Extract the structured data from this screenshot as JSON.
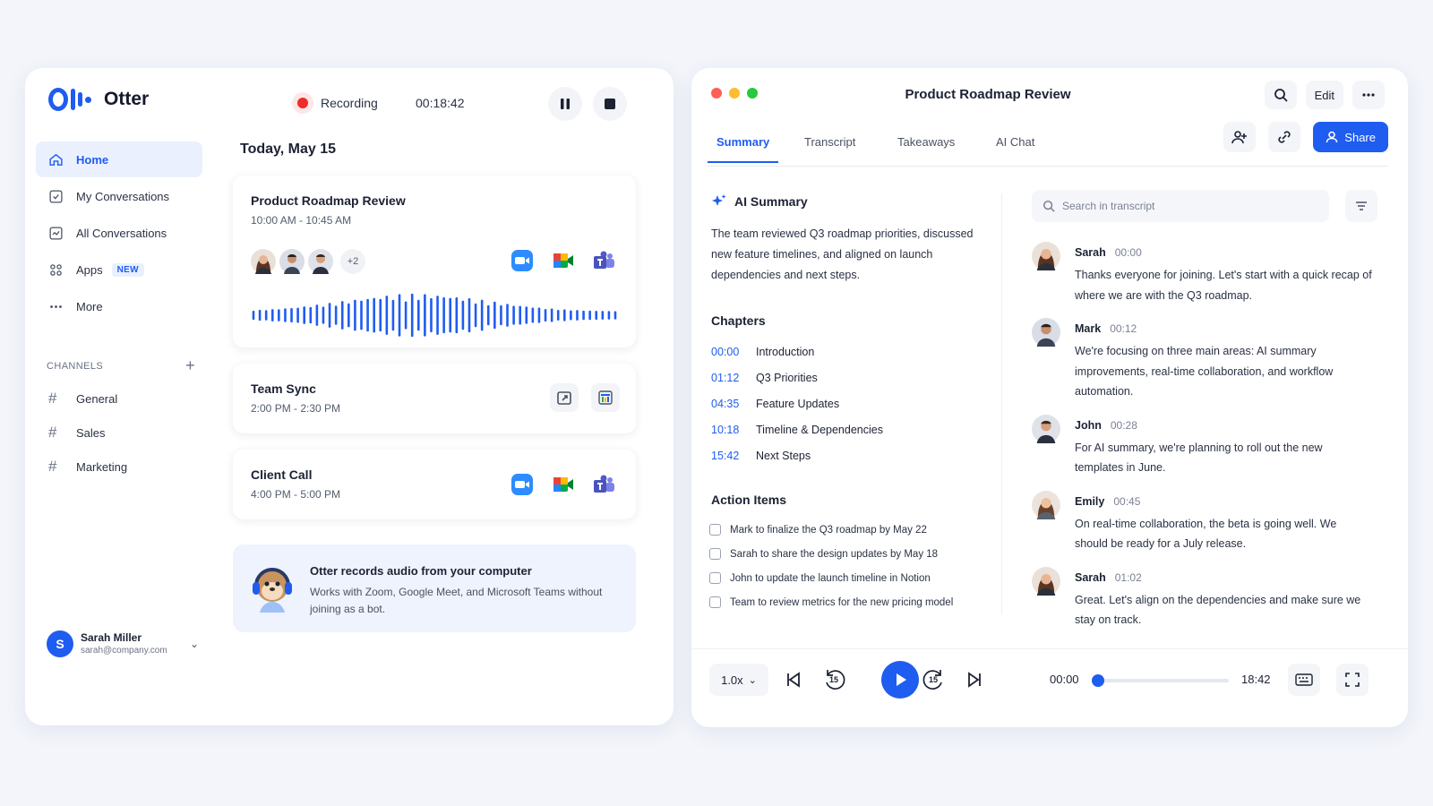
{
  "app": {
    "name": "Otter",
    "brand_color": "#1f5cf0"
  },
  "sidebar": {
    "items": [
      {
        "label": "Home",
        "icon": "home-icon",
        "active": true
      },
      {
        "label": "My Conversations",
        "icon": "conversation-check-icon"
      },
      {
        "label": "All Conversations",
        "icon": "conversation-list-icon"
      },
      {
        "label": "Apps",
        "icon": "apps-grid-icon",
        "badge": "NEW"
      },
      {
        "label": "More",
        "icon": "more-dots-icon"
      }
    ],
    "channels_heading": "CHANNELS",
    "channels": [
      "General",
      "Sales",
      "Marketing"
    ],
    "user": {
      "initial": "S",
      "name": "Sarah Miller",
      "email": "sarah@company.com"
    }
  },
  "recording": {
    "label": "Recording",
    "elapsed": "00:18:42"
  },
  "today": {
    "heading": "Today, May 15",
    "meetings": [
      {
        "title": "Product Roadmap Review",
        "time": "10:00 AM - 10:45 AM",
        "extra_participants": "+2",
        "apps": [
          "zoom-icon",
          "google-meet-icon",
          "teams-icon"
        ]
      },
      {
        "title": "Team Sync",
        "time": "2:00 PM - 2:30 PM",
        "apps": [
          "calendar-share-icon",
          "calendar-chart-icon"
        ]
      },
      {
        "title": "Client Call",
        "time": "4:00 PM - 5:00 PM",
        "apps": [
          "zoom-icon",
          "google-meet-icon",
          "teams-icon"
        ]
      }
    ]
  },
  "promo": {
    "title": "Otter records audio from your computer",
    "text": "Works with Zoom, Google Meet, and Microsoft Teams without joining as a bot."
  },
  "detail": {
    "title": "Product Roadmap Review",
    "edit_label": "Edit",
    "share_label": "Share",
    "tabs": [
      "Summary",
      "Transcript",
      "Takeaways",
      "AI Chat"
    ],
    "active_tab": "Summary",
    "ai_summary_heading": "AI Summary",
    "ai_summary_text": "The team reviewed Q3 roadmap priorities, discussed new feature timelines, and aligned on launch dependencies and next steps.",
    "chapters_heading": "Chapters",
    "chapters": [
      {
        "ts": "00:00",
        "title": "Introduction"
      },
      {
        "ts": "01:12",
        "title": "Q3 Priorities"
      },
      {
        "ts": "04:35",
        "title": "Feature Updates"
      },
      {
        "ts": "10:18",
        "title": "Timeline & Dependencies"
      },
      {
        "ts": "15:42",
        "title": "Next Steps"
      }
    ],
    "action_items_heading": "Action Items",
    "action_items": [
      "Mark to finalize the Q3 roadmap by May 22",
      "Sarah to share the design updates by May 18",
      "John to update the launch timeline in Notion",
      "Team to review metrics for the new pricing model"
    ],
    "search_placeholder": "Search in transcript",
    "transcript": [
      {
        "speaker": "Sarah",
        "ts": "00:00",
        "text": "Thanks everyone for joining. Let's start with a quick recap of where we are with the Q3 roadmap."
      },
      {
        "speaker": "Mark",
        "ts": "00:12",
        "text": "We're focusing on three main areas: AI summary improvements, real-time collaboration, and workflow automation."
      },
      {
        "speaker": "John",
        "ts": "00:28",
        "text": "For AI summary, we're planning to roll out the new templates in June."
      },
      {
        "speaker": "Emily",
        "ts": "00:45",
        "text": "On real-time collaboration, the beta is going well. We should be ready for a July release."
      },
      {
        "speaker": "Sarah",
        "ts": "01:02",
        "text": "Great. Let's align on the dependencies and make sure we stay on track."
      }
    ]
  },
  "player": {
    "speed": "1.0x",
    "current": "00:00",
    "total": "18:42",
    "progress": 0.0,
    "skip_seconds": "15"
  }
}
